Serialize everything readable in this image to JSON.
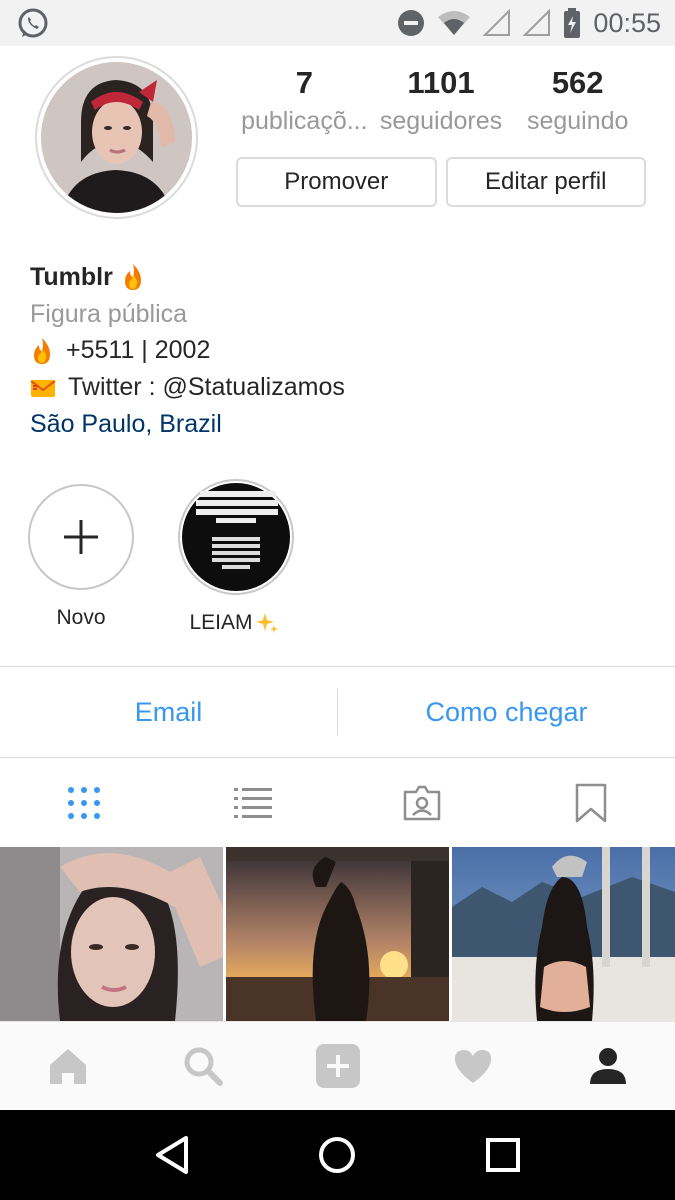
{
  "status_bar": {
    "time": "00:55",
    "icons": [
      "whatsapp-icon",
      "do-not-disturb-icon",
      "wifi-icon",
      "signal-icon",
      "signal-icon",
      "battery-icon"
    ]
  },
  "profile": {
    "stats": [
      {
        "value": "7",
        "label": "publicaçõ..."
      },
      {
        "value": "1101",
        "label": "seguidores"
      },
      {
        "value": "562",
        "label": "seguindo"
      }
    ],
    "buttons": {
      "promote": "Promover",
      "edit": "Editar perfil"
    }
  },
  "bio": {
    "name": "Tumblr",
    "name_emoji": "fire-emoji",
    "category": "Figura pública",
    "line1": "+5511 | 2002",
    "line1_emoji": "fire-emoji",
    "line2": "Twitter : @Statualizamos",
    "line2_emoji": "incoming-envelope-emoji",
    "location": "São Paulo, Brazil"
  },
  "highlights": [
    {
      "label": "Novo",
      "icon": "plus-icon"
    },
    {
      "label": "LEIAM",
      "icon": "sparkles-emoji"
    }
  ],
  "contact": {
    "email": "Email",
    "directions": "Como chegar"
  },
  "tabs": [
    "grid-icon",
    "list-icon",
    "tagged-icon",
    "bookmark-icon"
  ],
  "active_tab": "grid-icon",
  "bottom_nav": [
    "home-icon",
    "search-icon",
    "add-post-icon",
    "heart-icon",
    "profile-icon"
  ],
  "colors": {
    "link_blue": "#3897f0",
    "location_blue": "#003569",
    "muted_gray": "#999999",
    "border": "#dbdbdb",
    "text": "#262626"
  }
}
